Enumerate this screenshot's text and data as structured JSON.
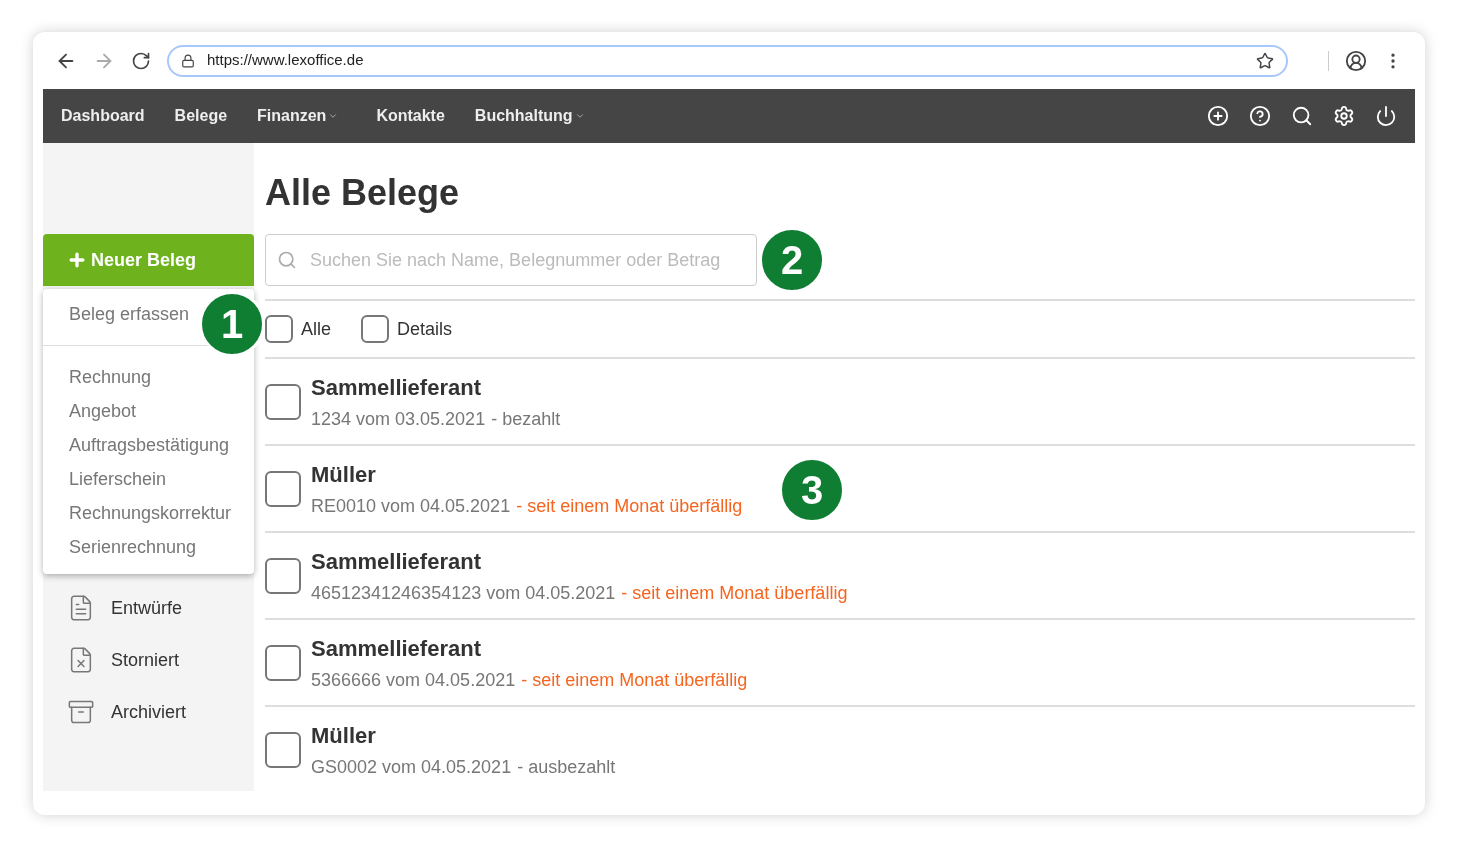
{
  "browser": {
    "url": "https://www.lexoffice.de"
  },
  "nav": {
    "items": [
      {
        "label": "Dashboard",
        "dropdown": false
      },
      {
        "label": "Belege",
        "dropdown": false
      },
      {
        "label": "Finanzen",
        "dropdown": true
      },
      {
        "label": "Kontakte",
        "dropdown": false
      },
      {
        "label": "Buchhaltung",
        "dropdown": true
      }
    ]
  },
  "new_button": {
    "label": "Neuer Beleg"
  },
  "dropdown": {
    "items": [
      {
        "label": "Beleg erfassen",
        "kind": "primary",
        "marker": "1"
      },
      {
        "label": "Rechnung",
        "kind": "item"
      },
      {
        "label": "Angebot",
        "kind": "item"
      },
      {
        "label": "Auftragsbestätigung",
        "kind": "item"
      },
      {
        "label": "Lieferschein",
        "kind": "item"
      },
      {
        "label": "Rechnungskorrektur",
        "kind": "item"
      },
      {
        "label": "Serienrechnung",
        "kind": "item"
      }
    ]
  },
  "sidebar": {
    "items": [
      {
        "label": "Entwürfe",
        "kind": "draft"
      },
      {
        "label": "Storniert",
        "kind": "cancelled"
      },
      {
        "label": "Archiviert",
        "kind": "archive"
      }
    ]
  },
  "page_title": "Alle Belege",
  "search": {
    "placeholder": "Suchen Sie nach Name, Belegnummer oder Betrag",
    "marker": "2"
  },
  "filters": [
    {
      "label": "Alle",
      "checked": false
    },
    {
      "label": "Details",
      "checked": false
    }
  ],
  "rows": [
    {
      "title": "Sammellieferant",
      "reference": "1234 vom 03.05.2021",
      "status": "- bezahlt",
      "overdue": false,
      "checked": false
    },
    {
      "title": "Müller",
      "reference": "RE0010 vom 04.05.2021",
      "status": "- seit einem Monat überfällig",
      "overdue": true,
      "checked": false,
      "marker": "3"
    },
    {
      "title": "Sammellieferant",
      "reference": "46512341246354123 vom 04.05.2021",
      "status": "- seit einem Monat überfällig",
      "overdue": true,
      "checked": false
    },
    {
      "title": "Sammellieferant",
      "reference": "5366666 vom 04.05.2021",
      "status": "- seit einem Monat überfällig",
      "overdue": true,
      "checked": false
    },
    {
      "title": "Müller",
      "reference": "GS0002 vom 04.05.2021",
      "status": "- ausbezahlt",
      "overdue": false,
      "checked": false
    }
  ]
}
